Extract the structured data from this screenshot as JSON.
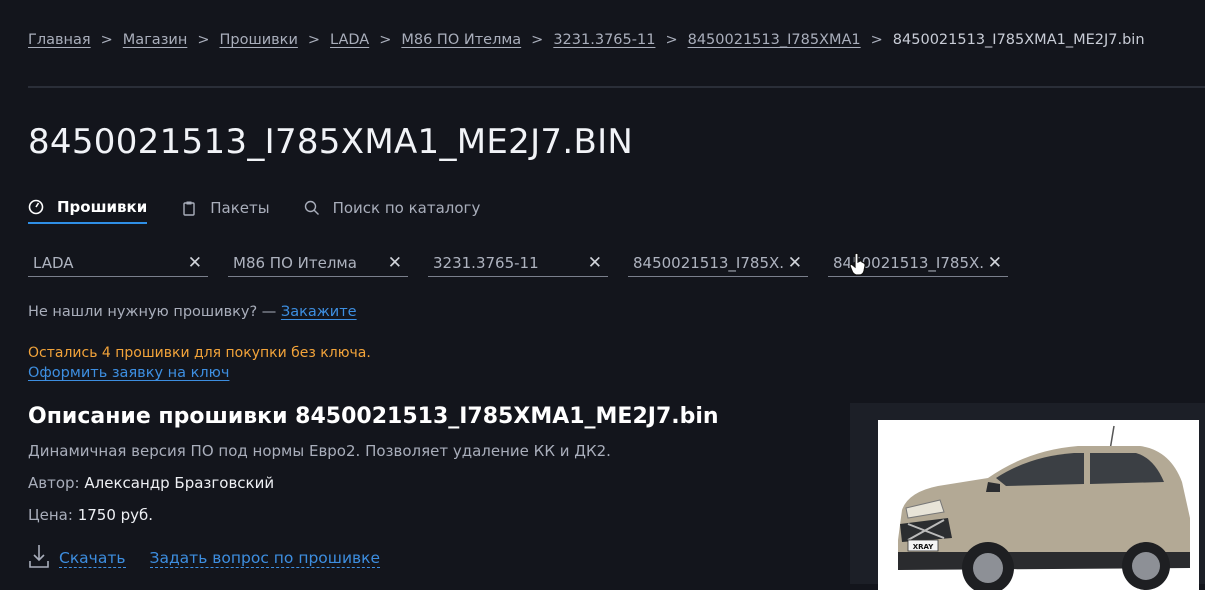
{
  "breadcrumb": {
    "items": [
      "Главная",
      "Магазин",
      "Прошивки",
      "LADA",
      "М86 ПО Ителма",
      "3231.3765-11",
      "8450021513_I785XMA1"
    ],
    "current": "8450021513_I785XMA1_ME2J7.bin",
    "separator": ">"
  },
  "page_title": "8450021513_I785XMA1_ME2J7.BIN",
  "tabs": [
    {
      "label": "Прошивки",
      "icon": "speedometer-icon",
      "active": true
    },
    {
      "label": "Пакеты",
      "icon": "clipboard-icon",
      "active": false
    },
    {
      "label": "Поиск по каталогу",
      "icon": "search-icon",
      "active": false
    }
  ],
  "filters": [
    {
      "value": "LADA"
    },
    {
      "value": "М86 ПО Ителма"
    },
    {
      "value": "3231.3765-11"
    },
    {
      "value": "8450021513_I785X.."
    },
    {
      "value": "8450021513_I785X.."
    }
  ],
  "filter_clear_glyph": "✕",
  "not_found": {
    "text": "Не нашли нужную прошивку? — ",
    "link": "Закажите"
  },
  "warning": "Остались 4 прошивки для покупки без ключа.",
  "key_request_link": "Оформить заявку на ключ",
  "description": {
    "title": "Описание прошивки 8450021513_I785XMA1_ME2J7.bin",
    "text": "Динамичная версия ПО под нормы Евро2. Позволяет удаление КК и ДК2.",
    "author_label": "Автор:",
    "author": "Александр Бразговский",
    "price_label": "Цена:",
    "price": "1750 руб."
  },
  "actions": {
    "download": "Скачать",
    "ask": "Задать вопрос по прошивке"
  },
  "product_image": {
    "badge": "XRAY"
  },
  "colors": {
    "accent": "#3d8ee0",
    "warning": "#f2a33a",
    "background": "#13151c",
    "tab_underline": "#2f8fe6"
  }
}
